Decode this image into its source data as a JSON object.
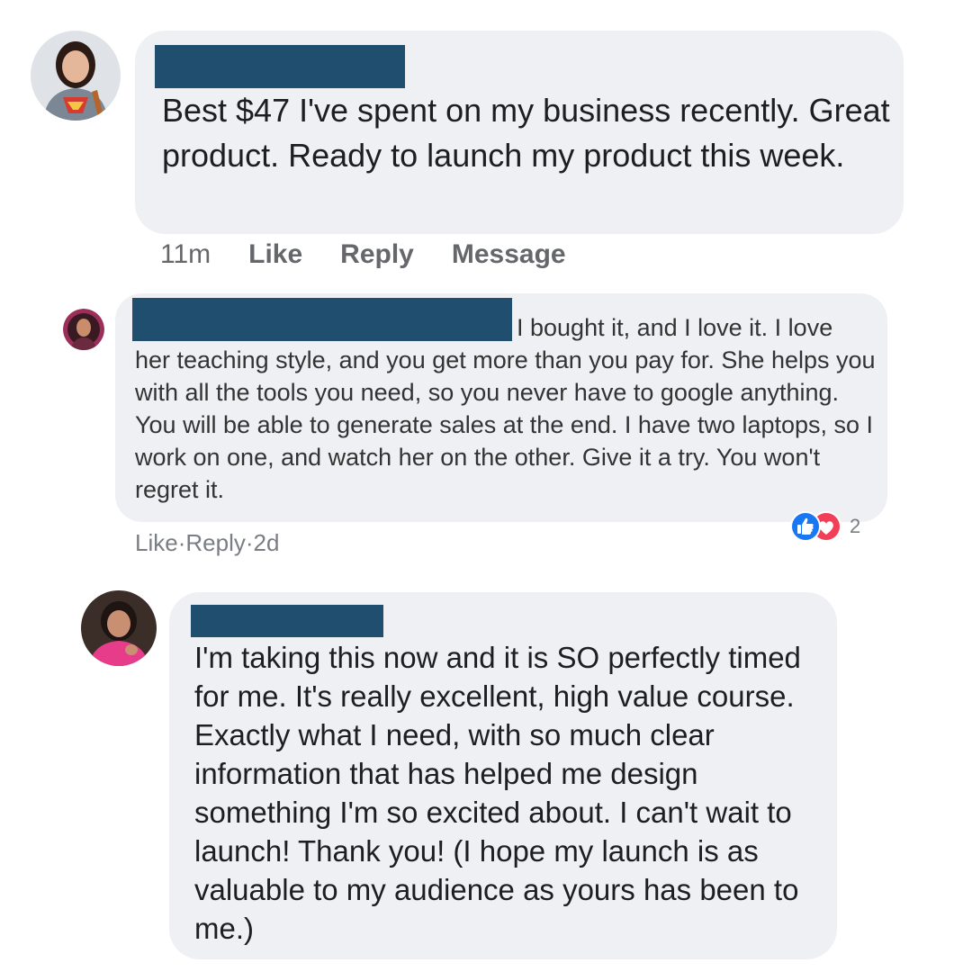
{
  "comments": [
    {
      "text": "Best $47 I've spent on my business recently. Great product. Ready to launch my product this week.",
      "actions": {
        "time": "11m",
        "like": "Like",
        "reply": "Reply",
        "message": "Message"
      }
    },
    {
      "text_first": "I bought it, and I love it. I love",
      "text_rest": "her teaching style, and you get more than you pay for. She helps you with all the tools you need, so you never have to google anything. You will be able to generate sales at the end. I have two laptops, so I work on one, and watch her on the other. Give it a try. You won't regret it.",
      "actions": {
        "like": "Like",
        "sep1": " · ",
        "reply": "Reply",
        "sep2": " · ",
        "time": "2d"
      },
      "reactions": {
        "icons": [
          "thumbs-up-icon",
          "heart-icon"
        ],
        "count": "2",
        "colors": {
          "like": "#1877f2",
          "love": "#f33e58"
        }
      }
    },
    {
      "text": "I'm taking this now and it is SO perfectly timed for me. It's really excellent, high value course. Exactly what I need, with so much clear information that has helped me design something I'm so excited about. I can't wait to launch! Thank you! (I hope my launch is as valuable to my audience as yours has been to me.)"
    }
  ],
  "colors": {
    "bubble": "#eef0f3",
    "redaction": "#1f4e6e",
    "meta_text": "#65676b"
  }
}
